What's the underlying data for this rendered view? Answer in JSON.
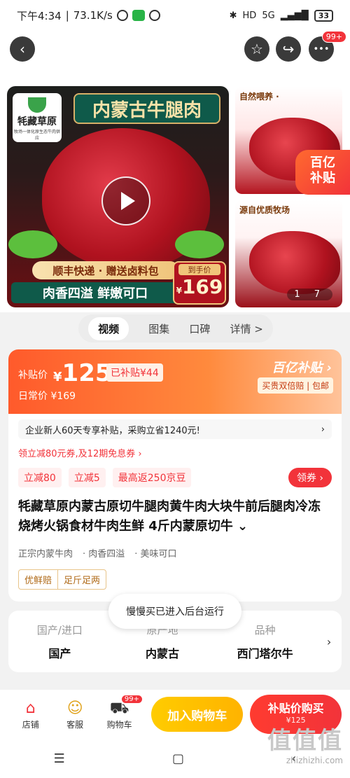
{
  "status_bar": {
    "time": "下午4:34",
    "network_speed": "73.1K/s",
    "signal": "5G",
    "battery": "33"
  },
  "topnav": {
    "back_icon": "‹",
    "favorite_icon": "☆",
    "share_icon": "↪",
    "more_icon": "•••",
    "more_badge": "99+"
  },
  "gallery": {
    "brand_name": "牦藏草原",
    "brand_tagline": "牧场一体化原生态牛肉供应",
    "banner": "内蒙古牛腿肉",
    "ribbon": "顺丰快递 · 赠送卤料包",
    "slogan": "肉香四溢  鲜嫩可口",
    "price_tag_label": "到手价",
    "price_tag_currency": "¥",
    "price_tag_value": "169",
    "side1_caption": "自然喂养 ·",
    "side2_caption": "源自优质牧场",
    "counter": "1 7",
    "yibutie_line1": "百亿",
    "yibutie_line2": "补贴"
  },
  "tabs": [
    "视频",
    "图集",
    "口碑",
    "详情 >"
  ],
  "price": {
    "sub_label": "补贴价",
    "sub_currency": "¥",
    "sub_value": "125",
    "sub_badge": "已补贴¥44",
    "daily_label": "日常价",
    "daily_value": "¥169",
    "yi_logo": "百亿补贴 ›",
    "guarantee": "买贵双倍赔 | 包邮"
  },
  "notice": {
    "text": "企业新人60天专享补贴，采购立省1240元!",
    "arrow": "›"
  },
  "coupon_line": "领立减80元券,及12期免息券 ›",
  "chips": [
    "立减80",
    "立减5",
    "最高返250京豆"
  ],
  "ling_button": "领券 ›",
  "product_title": "牦藏草原内蒙古原切牛腿肉黄牛肉大块牛前后腿肉冷冻烧烤火锅食材牛肉生鲜 4斤内蒙原切牛 ⌄",
  "tags": [
    "正宗内蒙牛肉",
    "·  肉香四溢",
    "·  美味可口"
  ],
  "assure": [
    "优鲜赔",
    "足斤足两"
  ],
  "toast": "慢慢买已进入后台运行",
  "attributes": [
    {
      "key": "国产/进口",
      "value": "国产"
    },
    {
      "key": "原产地",
      "value": "内蒙古"
    },
    {
      "key": "品种",
      "value": "西门塔尔牛"
    }
  ],
  "attr_arrow": "›",
  "bottom_bar": {
    "store": "店铺",
    "service": "客服",
    "cart": "购物车",
    "cart_badge": "99+",
    "add_cart": "加入购物车",
    "buy_main": "补贴价购买",
    "buy_sub": "¥125"
  },
  "system_nav": [
    "☰",
    "▢",
    "‹"
  ],
  "watermark": {
    "big": "值值值",
    "small": "zhizhizhi.com"
  }
}
